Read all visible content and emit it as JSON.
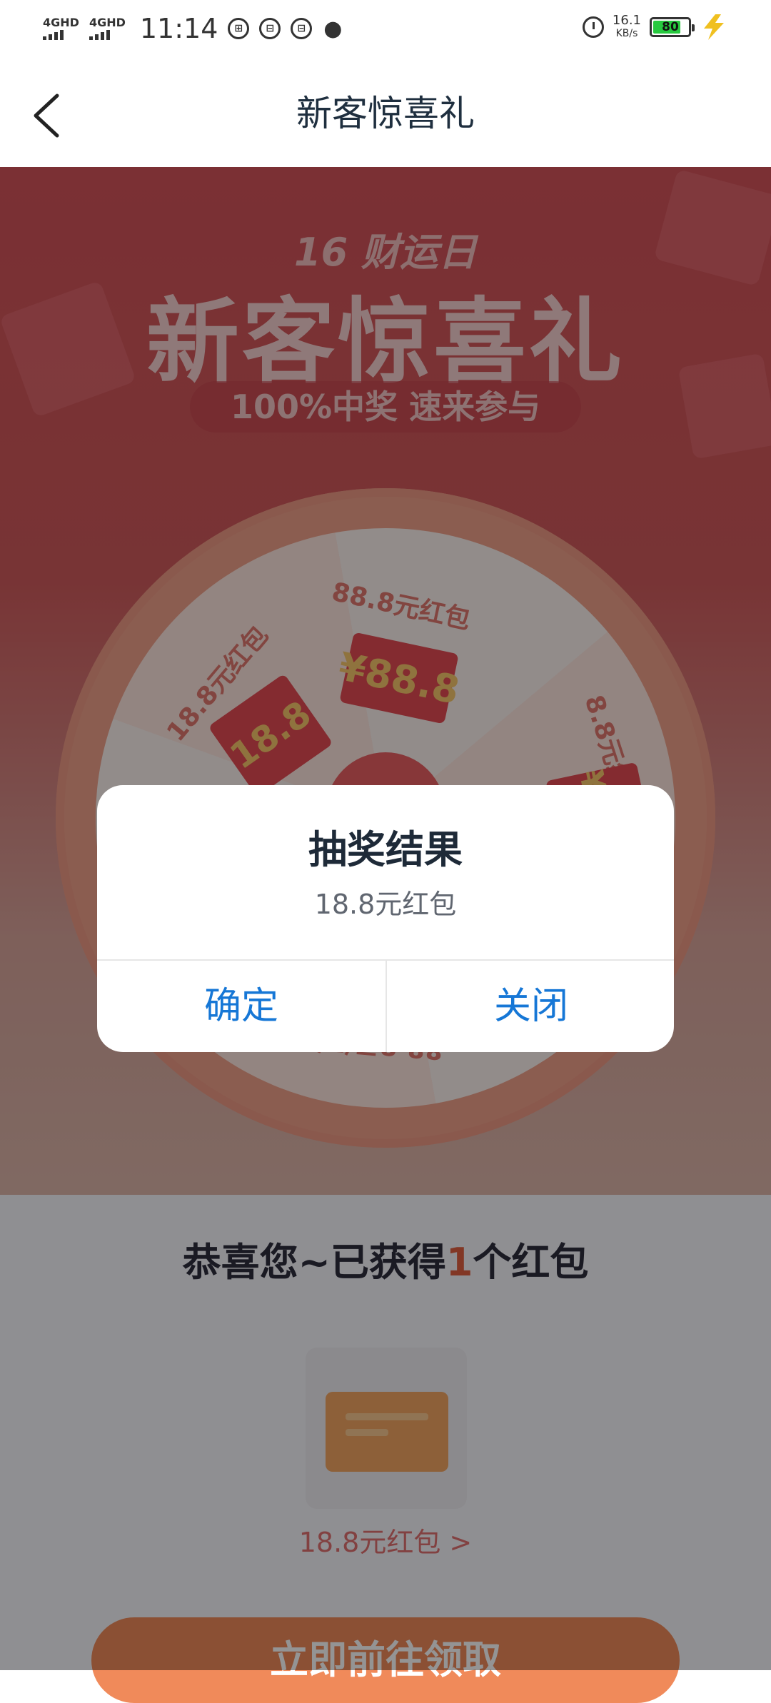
{
  "status_bar": {
    "network1": "4GHD",
    "network2": "4GHD",
    "time": "11:14",
    "speed_value": "16.1",
    "speed_unit": "KB/s",
    "battery": "80"
  },
  "header": {
    "title": "新客惊喜礼"
  },
  "banner": {
    "subtitle": "16 财运日",
    "title": "新客惊喜礼",
    "pill": "100%中奖 速来参与"
  },
  "wheel": {
    "segments": [
      {
        "label": "18.8元红包",
        "ticket": "18.8"
      },
      {
        "label": "88.8元红包",
        "ticket": "¥88.8"
      },
      {
        "label": "8.8元红包",
        "ticket": "¥8.8"
      },
      {
        "label": "88.8元红包"
      }
    ]
  },
  "result": {
    "congrats_prefix": "恭喜您~已获得",
    "count": "1",
    "congrats_suffix": "个红包",
    "prize_label": "18.8元红包 >",
    "claim_button": "立即前往领取"
  },
  "dialog": {
    "title": "抽奖结果",
    "message": "18.8元红包",
    "confirm": "确定",
    "close": "关闭"
  },
  "colors": {
    "accent_blue": "#1677d6",
    "banner_red": "#d4535a",
    "highlight": "#e06040"
  }
}
